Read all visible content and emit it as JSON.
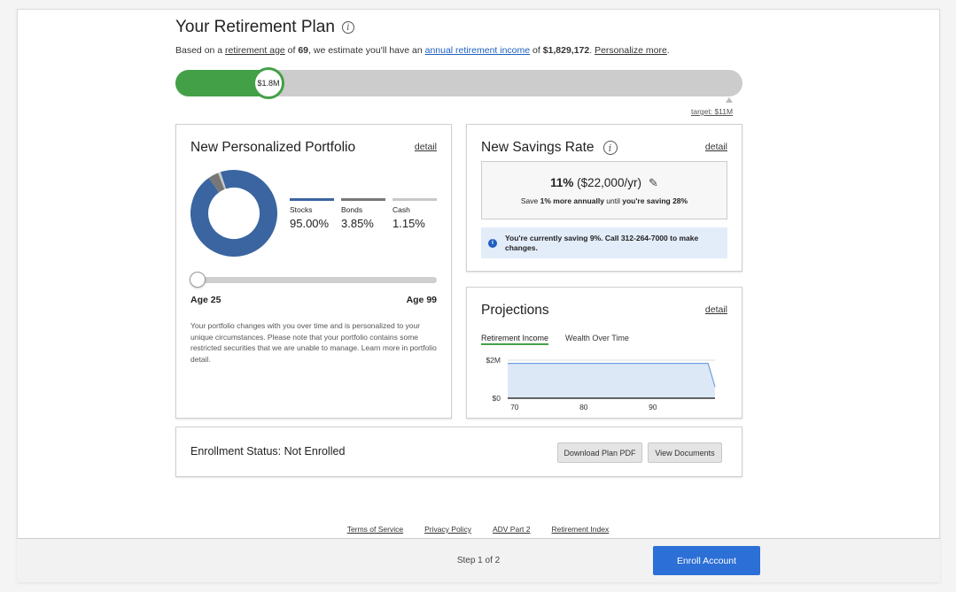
{
  "header": {
    "title": "Your Retirement Plan",
    "info_icon": "info-icon",
    "subtitle": {
      "prefix": "Based on a ",
      "retirement_age_link": "retirement age",
      "of": " of ",
      "age_value": "69",
      "middle": ", we estimate you'll have an ",
      "income_link": "annual retirement income",
      "of2": " of ",
      "income_value": "$1,829,172",
      "period": ". ",
      "personalize_link": "Personalize more",
      "end": "."
    }
  },
  "progress": {
    "current_label": "$1.8M",
    "current_fraction": 0.164,
    "target_label": "target: $11M"
  },
  "portfolio": {
    "title": "New Personalized Portfolio",
    "detail": "detail",
    "allocations": [
      {
        "name": "Stocks",
        "value": "95.00%",
        "percent": 95.0,
        "color": "#3a65a0"
      },
      {
        "name": "Bonds",
        "value": "3.85%",
        "percent": 3.85,
        "color": "#777777"
      },
      {
        "name": "Cash",
        "value": "1.15%",
        "percent": 1.15,
        "color": "#c8c8c8"
      }
    ],
    "age_min": "Age 25",
    "age_max": "Age 99",
    "description": "Your portfolio changes with you over time and is personalized to your unique circumstances. Please note that your portfolio contains some restricted securities that we are unable to manage. Learn more in portfolio detail."
  },
  "savings": {
    "title": "New Savings Rate",
    "detail": "detail",
    "rate_percent": "11%",
    "rate_amount": " ($22,000/yr)",
    "pencil_icon": "pencil-icon",
    "sub_prefix": "Save ",
    "sub_bold1": "1% more annually",
    "sub_mid": " until ",
    "sub_bold2": "you're saving 28%",
    "notice": "You're currently saving 9%. Call 312-264-7000 to make changes."
  },
  "projections": {
    "title": "Projections",
    "detail": "detail",
    "tabs": [
      "Retirement Income",
      "Wealth Over Time"
    ],
    "active_tab": 0
  },
  "chart_data": {
    "type": "area",
    "x": [
      69,
      70,
      80,
      90,
      98,
      99
    ],
    "y": [
      1.83,
      1.83,
      1.83,
      1.83,
      1.83,
      0.6
    ],
    "ylim": [
      0,
      2
    ],
    "xlim": [
      69,
      99
    ],
    "yticks": [
      "$2M",
      "$0"
    ],
    "xticks": [
      "70",
      "80",
      "90"
    ],
    "xtick_values": [
      70,
      80,
      90
    ],
    "fill_color": "#dde8f7",
    "line_color": "#6fa2e0"
  },
  "enrollment": {
    "status": "Enrollment Status: Not Enrolled",
    "download_btn": "Download Plan PDF",
    "view_btn": "View Documents"
  },
  "footer": {
    "links": [
      "Terms of Service",
      "Privacy Policy",
      "ADV Part 2",
      "Retirement Index"
    ],
    "step": "Step 1 of 2",
    "enroll_btn": "Enroll Account"
  }
}
